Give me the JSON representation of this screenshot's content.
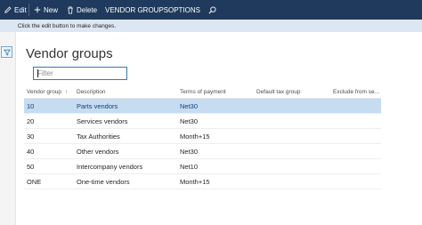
{
  "toolbar": {
    "edit_label": "Edit",
    "new_label": "New",
    "delete_label": "Delete",
    "vendor_groups_label": "VENDOR GROUPS",
    "options_label": "OPTIONS"
  },
  "message": {
    "text": "Click the edit button to make changes."
  },
  "page": {
    "title": "Vendor groups"
  },
  "filter": {
    "placeholder": "Filter",
    "value": ""
  },
  "grid": {
    "columns": [
      "Vendor group",
      "Description",
      "Terms of payment",
      "Default tax group",
      "Exclude from se..."
    ],
    "sort_indicator": "↑",
    "rows": [
      {
        "vendor_group": "10",
        "description": "Parts vendors",
        "terms": "Net30",
        "tax_group": "",
        "exclude": ""
      },
      {
        "vendor_group": "20",
        "description": "Services vendors",
        "terms": "Net30",
        "tax_group": "",
        "exclude": ""
      },
      {
        "vendor_group": "30",
        "description": "Tax Authorities",
        "terms": "Month+15",
        "tax_group": "",
        "exclude": ""
      },
      {
        "vendor_group": "40",
        "description": "Other vendors",
        "terms": "Net30",
        "tax_group": "",
        "exclude": ""
      },
      {
        "vendor_group": "50",
        "description": "Intercompany vendors",
        "terms": "Net10",
        "tax_group": "",
        "exclude": ""
      },
      {
        "vendor_group": "ONE",
        "description": "One-time vendors",
        "terms": "Month+15",
        "tax_group": "",
        "exclude": ""
      }
    ],
    "selected_row": 0
  },
  "icons": {
    "edit": "pencil-icon",
    "new": "plus-icon",
    "delete": "trash-icon",
    "search": "search-icon",
    "filter_pane": "funnel-icon"
  },
  "colors": {
    "toolbar_bg": "#1f3a5c",
    "message_bar_bg": "#dde7f3",
    "selected_row_bg": "#c6dcf1",
    "accent": "#2b7bc0"
  }
}
